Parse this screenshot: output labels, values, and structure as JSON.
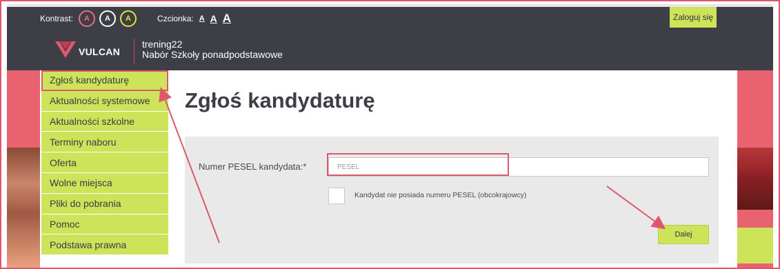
{
  "header": {
    "contrast_label": "Kontrast:",
    "contrast_options": [
      "A",
      "A",
      "A"
    ],
    "font_label": "Czcionka:",
    "font_options": [
      "A",
      "A",
      "A"
    ],
    "login_label": "Zaloguj się",
    "logo_text": "VULCAN",
    "institution_line1": "trening22",
    "institution_line2": "Nabór Szkoły ponadpodstawowe"
  },
  "menu": {
    "items": [
      "Zgłoś kandydaturę",
      "Aktualności systemowe",
      "Aktualności szkolne",
      "Terminy naboru",
      "Oferta",
      "Wolne miejsca",
      "Pliki do pobrania",
      "Pomoc",
      "Podstawa prawna"
    ],
    "active_index": 0
  },
  "main": {
    "title": "Zgłoś kandydaturę",
    "pesel_label": "Numer PESEL kandydata:*",
    "pesel_placeholder": "PESEL",
    "pesel_value": "",
    "no_pesel_label": "Kandydat nie posiada numeru PESEL (obcokrajowcy)",
    "no_pesel_checked": false,
    "next_button": "Dalej"
  },
  "colors": {
    "header_bg": "#3d3e46",
    "accent_green": "#cde35a",
    "accent_red": "#e0566a",
    "side_salmon": "#e8636f"
  }
}
